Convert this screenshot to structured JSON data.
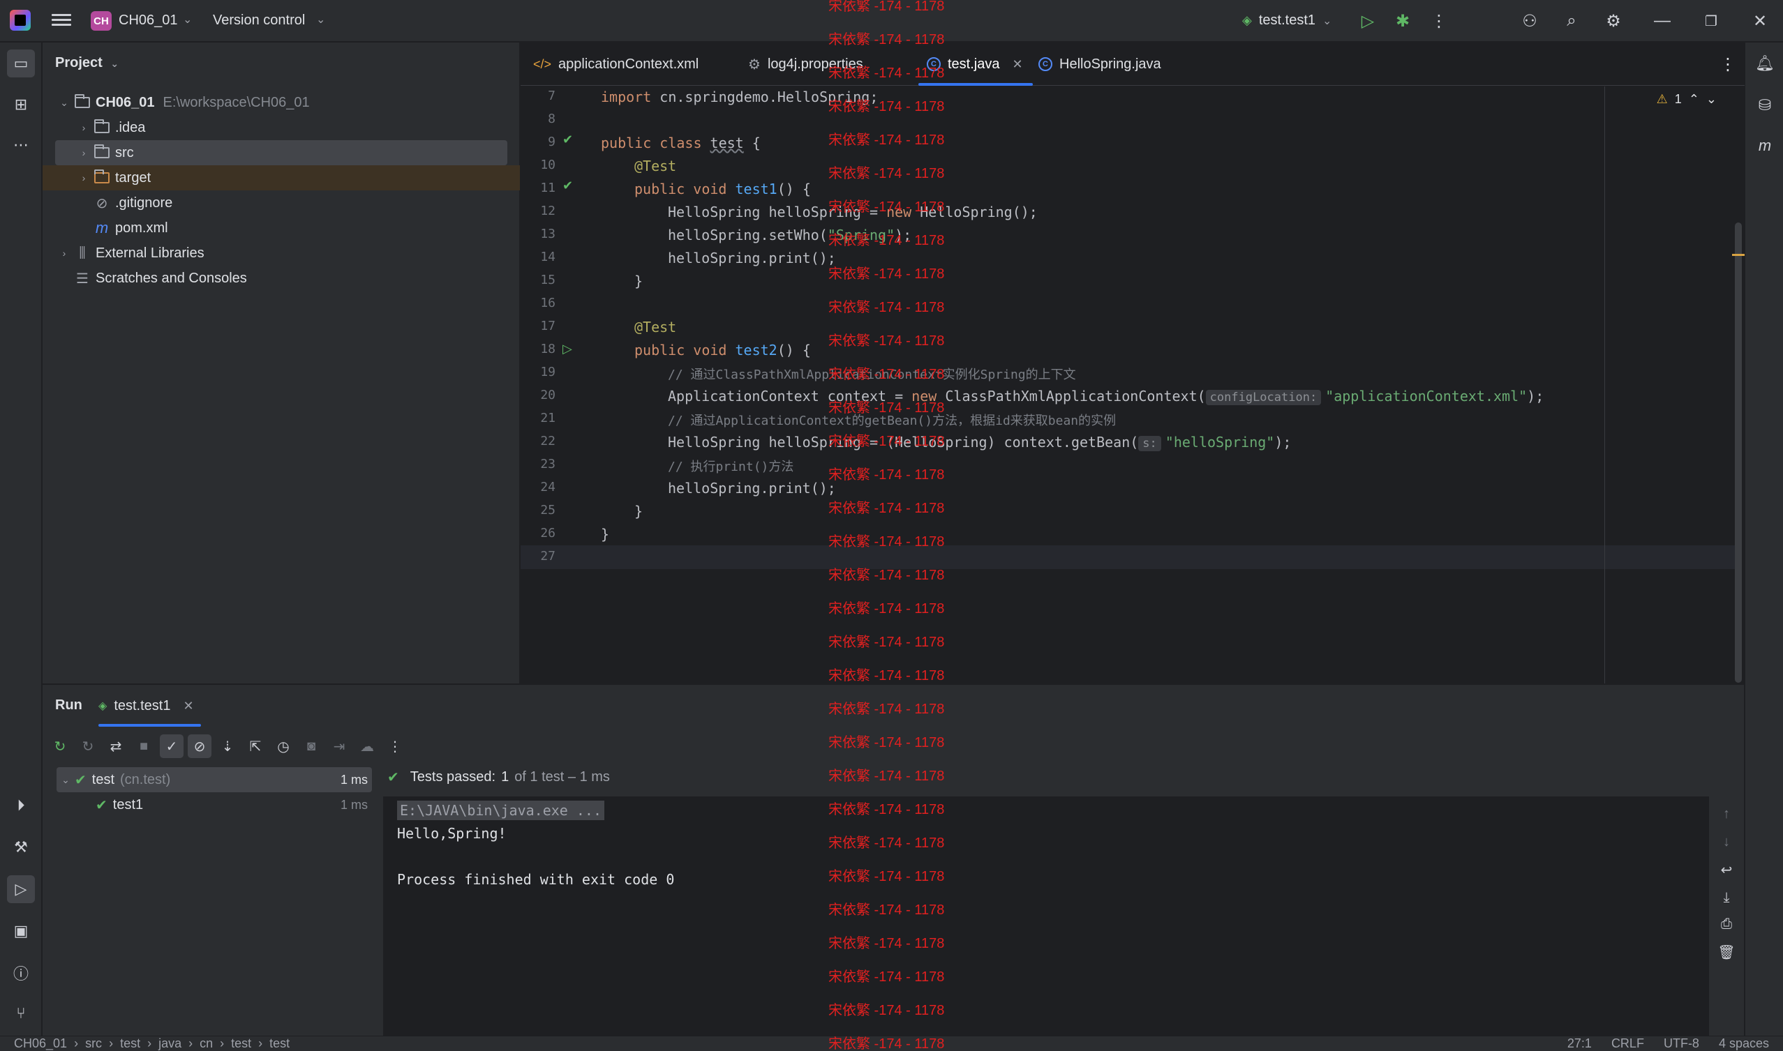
{
  "titlebar": {
    "project_badge": "CH",
    "project_name": "CH06_01",
    "vcs_label": "Version control",
    "run_config": "test.test1"
  },
  "project_panel": {
    "header": "Project",
    "tree": [
      {
        "label": "CH06_01",
        "path": "E:\\workspace\\CH06_01"
      },
      {
        "label": ".idea"
      },
      {
        "label": "src"
      },
      {
        "label": "target"
      },
      {
        "label": ".gitignore"
      },
      {
        "label": "pom.xml",
        "icon_letter": "m"
      },
      {
        "label": "External Libraries"
      },
      {
        "label": "Scratches and Consoles"
      }
    ]
  },
  "editor_tabs": [
    {
      "label": "applicationContext.xml"
    },
    {
      "label": "log4j.properties"
    },
    {
      "label": "test.java"
    },
    {
      "label": "HelloSpring.java"
    }
  ],
  "editor": {
    "warning_count": "1",
    "line_numbers": [
      "7",
      "8",
      "9",
      "10",
      "11",
      "12",
      "13",
      "14",
      "15",
      "16",
      "17",
      "18",
      "19",
      "20",
      "21",
      "22",
      "23",
      "24",
      "25",
      "26",
      "27"
    ],
    "lines": {
      "l7": {
        "a": "import ",
        "b": "cn.springdemo.HelloSpring;"
      },
      "l9": {
        "a": "public class ",
        "b": "test",
        "c": " {"
      },
      "l10": "@Test",
      "l11": {
        "a": "public void ",
        "b": "test1",
        "c": "() {"
      },
      "l12": {
        "a": "HelloSpring helloSpring = ",
        "b": "new ",
        "c": "HelloSpring();"
      },
      "l13": {
        "a": "helloSpring.setWho(",
        "b": "\"Spring\"",
        "c": ");"
      },
      "l14": "helloSpring.print();",
      "l15": "}",
      "l17": "@Test",
      "l18": {
        "a": "public void ",
        "b": "test2",
        "c": "() {"
      },
      "l19": "// 通过ClassPathXmlApplicationContext实例化Spring的上下文",
      "l20": {
        "a": "ApplicationContext context = ",
        "b": "new ",
        "c": "ClassPathXmlApplicationContext(",
        "hint": "configLocation:",
        "d": "\"applicationContext.xml\"",
        "e": ");"
      },
      "l21": "// 通过ApplicationContext的getBean()方法，根据id来获取bean的实例",
      "l22": {
        "a": "HelloSpring helloSpring = (HelloSpring) context.getBean(",
        "hint": "s:",
        "b": "\"helloSpring\"",
        "c": ");"
      },
      "l23": "// 执行print()方法",
      "l24": "helloSpring.print();",
      "l25": "}",
      "l26": "}"
    }
  },
  "watermark": "宋依繁 -174 - 1178",
  "run_panel": {
    "title": "Run",
    "tab": "test.test1",
    "tests": [
      {
        "name": "test",
        "pkg": "(cn.test)",
        "duration": "1 ms"
      },
      {
        "name": "test1",
        "duration": "1 ms"
      }
    ],
    "status": {
      "label": "Tests passed:",
      "count": "1",
      "rest": "of 1 test – 1 ms"
    },
    "console": [
      "E:\\JAVA\\bin\\java.exe ...",
      "Hello,Spring!",
      "",
      "Process finished with exit code 0"
    ]
  },
  "statusbar": {
    "breadcrumb": [
      "CH06_01",
      "src",
      "test",
      "java",
      "cn",
      "test",
      "test"
    ],
    "position": "27:1",
    "line_sep": "CRLF",
    "encoding": "UTF-8",
    "indent": "4 spaces"
  },
  "colors": {
    "accent": "#3574f0",
    "pass": "#5fb865",
    "watermark": "#e02020"
  }
}
